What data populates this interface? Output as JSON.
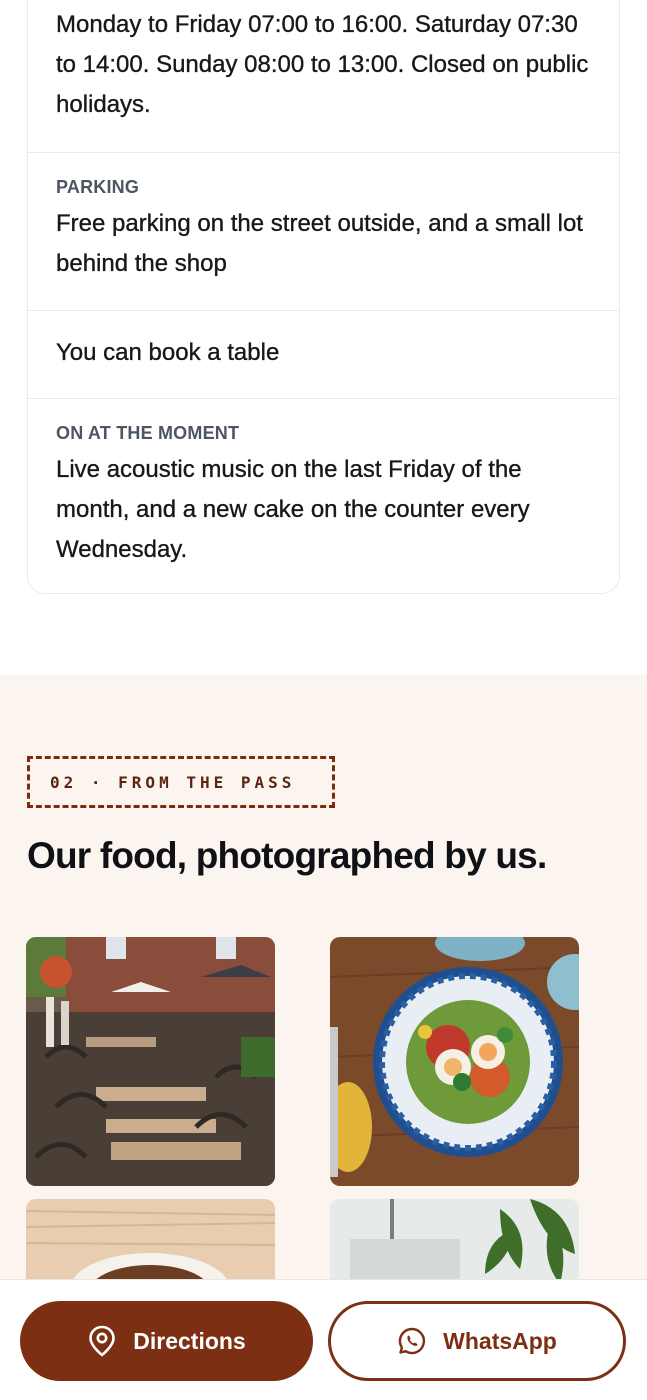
{
  "info": {
    "hours_text": "Monday to Friday 07:00 to 16:00. Saturday 07:30 to 14:00. Sunday 08:00 to 13:00. Closed on public holidays.",
    "parking_label": "PARKING",
    "parking_text": "Free parking on the street outside, and a small lot behind the shop",
    "booking_text": "You can book a table",
    "events_label": "ON AT THE MOMENT",
    "events_text": "Live acoustic music on the last Friday of the month, and a new cake on the counter every Wednesday."
  },
  "food": {
    "eyebrow": "02 · FROM THE PASS",
    "title": "Our food, photographed by us.",
    "photos": [
      "terrace-photo",
      "breakfast-bowl-photo",
      "coffee-photo",
      "interior-plant-photo"
    ]
  },
  "actions": {
    "directions_label": "Directions",
    "directions_icon": "map-pin-icon",
    "whatsapp_label": "WhatsApp",
    "whatsapp_icon": "whatsapp-icon"
  },
  "colors": {
    "brand": "#7c2f12",
    "section_bg": "#fcf4ee"
  }
}
